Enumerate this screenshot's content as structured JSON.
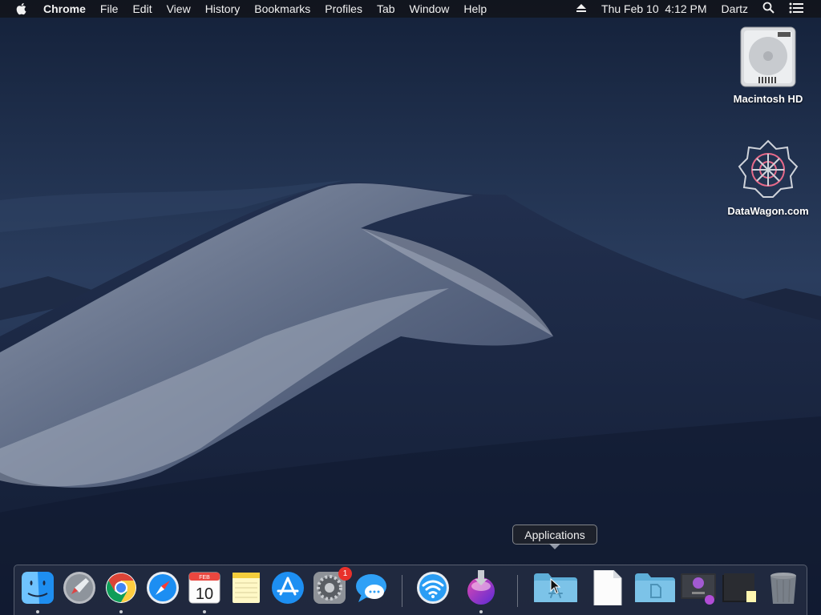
{
  "menubar": {
    "apple_icon": "apple-logo-icon",
    "app_name": "Chrome",
    "menus": [
      "File",
      "Edit",
      "View",
      "History",
      "Bookmarks",
      "Profiles",
      "Tab",
      "Window",
      "Help"
    ],
    "eject_icon": "eject-icon",
    "datetime": "Thu Feb 10  4:12 PM",
    "user": "Dartz",
    "search_icon": "spotlight-search-icon",
    "control_icon": "notification-center-icon"
  },
  "desktop": {
    "icons": [
      {
        "label": "Macintosh HD",
        "icon": "hard-drive-icon"
      },
      {
        "label": "DataWagon.com",
        "icon": "network-volume-icon"
      }
    ]
  },
  "dock": {
    "apps": [
      {
        "name": "Finder",
        "icon": "finder-icon",
        "running": true
      },
      {
        "name": "Launchpad",
        "icon": "launchpad-icon",
        "running": false
      },
      {
        "name": "Google Chrome",
        "icon": "chrome-icon",
        "running": true
      },
      {
        "name": "Safari",
        "icon": "safari-icon",
        "running": false
      },
      {
        "name": "Calendar",
        "icon": "calendar-icon",
        "running": true,
        "month": "FEB",
        "day": "10"
      },
      {
        "name": "Notes",
        "icon": "notes-icon",
        "running": false
      },
      {
        "name": "App Store",
        "icon": "app-store-icon",
        "running": false
      },
      {
        "name": "System Preferences",
        "icon": "system-preferences-icon",
        "running": false,
        "badge": "1"
      },
      {
        "name": "Messages",
        "icon": "messages-icon",
        "running": false
      },
      {
        "name": "Wireless Diagnostics",
        "icon": "wifi-icon",
        "running": false
      },
      {
        "name": "Installer",
        "icon": "installer-icon",
        "running": true
      }
    ],
    "stacks": [
      {
        "name": "Applications",
        "icon": "applications-folder-icon"
      },
      {
        "name": "Document",
        "icon": "document-icon"
      },
      {
        "name": "Documents",
        "icon": "documents-folder-icon"
      },
      {
        "name": "Downloads",
        "icon": "downloads-stack-icon"
      },
      {
        "name": "Recent",
        "icon": "recent-stack-icon"
      },
      {
        "name": "Trash",
        "icon": "trash-icon"
      }
    ],
    "tooltip": "Applications"
  }
}
